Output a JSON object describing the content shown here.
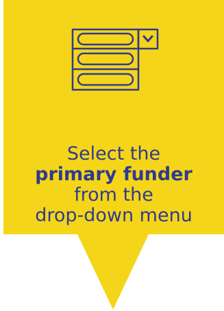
{
  "colors": {
    "background": "#ffffff",
    "callout_fill": "#f5d51a",
    "ink": "#2f3b8f"
  },
  "icon": {
    "name": "dropdown-menu-icon"
  },
  "message": {
    "line1": "Select the",
    "line2": "primary funder",
    "line3": "from the",
    "line4": "drop-down menu"
  }
}
